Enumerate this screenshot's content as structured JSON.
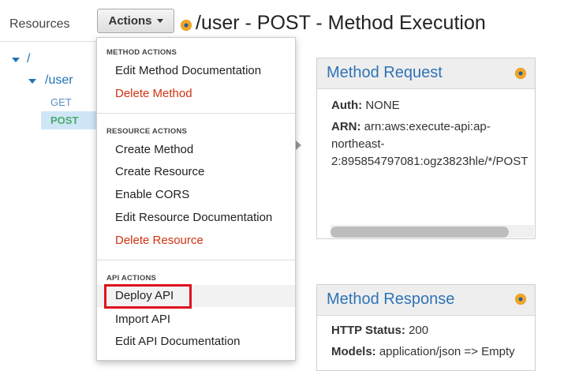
{
  "sidebar": {
    "title": "Resources",
    "tree": [
      {
        "label": "/"
      },
      {
        "label": "/user"
      }
    ],
    "methods": [
      "GET",
      "POST"
    ]
  },
  "toolbar": {
    "actions_label": "Actions"
  },
  "page": {
    "title": "/user - POST - Method Execution"
  },
  "actions_menu": {
    "sections": [
      {
        "heading": "METHOD ACTIONS",
        "items": [
          "Edit Method Documentation",
          "Delete Method"
        ]
      },
      {
        "heading": "RESOURCE ACTIONS",
        "items": [
          "Create Method",
          "Create Resource",
          "Enable CORS",
          "Edit Resource Documentation",
          "Delete Resource"
        ]
      },
      {
        "heading": "API ACTIONS",
        "items": [
          "Deploy API",
          "Import API",
          "Edit API Documentation"
        ]
      }
    ],
    "highlighted_item": "Deploy API"
  },
  "method_request": {
    "title": "Method Request",
    "auth_label": "Auth:",
    "auth_value": "NONE",
    "arn_label": "ARN:",
    "arn_line1": "arn:aws:execute-api:ap-",
    "arn_line2": "northeast-",
    "arn_line3": "2:895854797081:ogz3823hle/*/POST"
  },
  "method_response": {
    "title": "Method Response",
    "status_label": "HTTP Status:",
    "status_value": "200",
    "models_label": "Models:",
    "models_value": "application/json => Empty"
  },
  "colors": {
    "link_blue": "#1f73b7",
    "danger_red": "#d13212",
    "post_green": "#4bac6b",
    "highlight_red": "#e0101e",
    "selected_row": "#cfe6f7"
  }
}
